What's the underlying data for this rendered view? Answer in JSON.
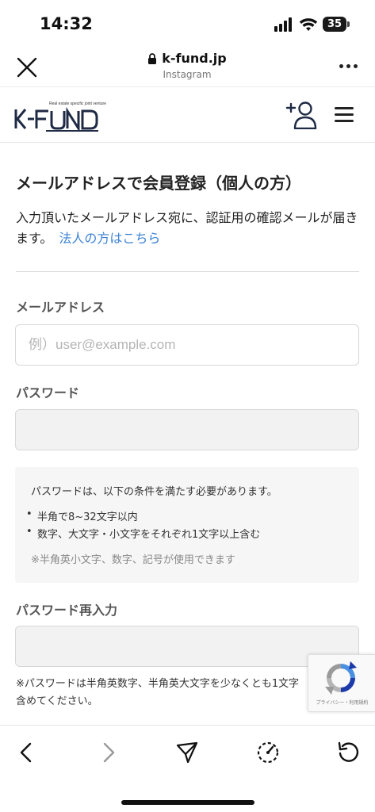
{
  "status_bar": {
    "time": "14:32",
    "battery": "35"
  },
  "browser": {
    "domain": "k-fund.jp",
    "source": "Instagram"
  },
  "site": {
    "logo_text": "K-FUND",
    "logo_tagline": "Real estate specific joint venture"
  },
  "form": {
    "title": "メールアドレスで会員登録（個人の方）",
    "intro": "入力頂いたメールアドレス宛に、認証用の確認メールが届きます。",
    "corporate_link": "法人の方はこちら",
    "email_label": "メールアドレス",
    "email_placeholder": "例）user@example.com",
    "password_label": "パスワード",
    "password_value": "",
    "requirements": {
      "intro": "パスワードは、以下の条件を満たす必要があります。",
      "items": [
        "半角で8~32文字以内",
        "数字、大文字・小文字をそれぞれ1文字以上含む"
      ],
      "note": "※半角英小文字、数字、記号が使用できます"
    },
    "password_confirm_label": "パスワード再入力",
    "password_confirm_value": "",
    "password_note": "※パスワードは半角英数字、半角英大文字を少なくとも1文字含めてください。"
  },
  "recaptcha": {
    "footer": "プライバシー・利用規約"
  },
  "colors": {
    "link": "#3b82d6",
    "logo_navy": "#1f2a44"
  },
  "icons": [
    "close-icon",
    "lock-icon",
    "more-icon",
    "user-add-icon",
    "menu-icon",
    "back-icon",
    "forward-icon",
    "share-icon",
    "speed-icon",
    "reload-icon",
    "recaptcha-icon"
  ]
}
